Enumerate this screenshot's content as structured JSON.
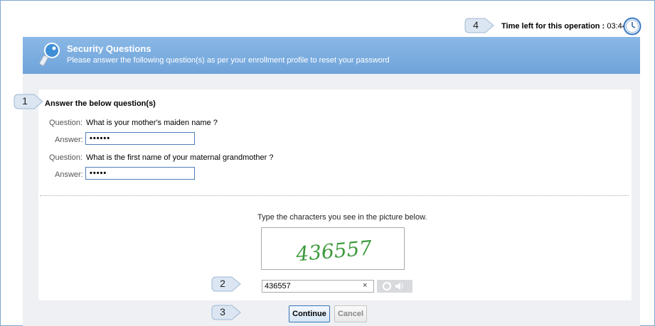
{
  "timer": {
    "label": "Time left for this operation :",
    "value": "03:44"
  },
  "header": {
    "title": "Security Questions",
    "subtitle": "Please answer the following question(s) as per your enrollment profile to reset your password"
  },
  "callouts": [
    "1",
    "2",
    "3",
    "4"
  ],
  "form": {
    "title": "Answer the below question(s)",
    "question_label": "Question:",
    "answer_label": "Answer:",
    "questions": [
      {
        "text": "What is your mother's maiden name ?",
        "answer_masked": "••••••"
      },
      {
        "text": "What is the first name of your maternal grandmother ?",
        "answer_masked": "•••••"
      }
    ]
  },
  "captcha": {
    "hint": "Type the characters you see in the picture below.",
    "image_text": "436557",
    "input_value": "436557",
    "clear_label": "×"
  },
  "buttons": {
    "continue": "Continue",
    "cancel": "Cancel"
  },
  "colors": {
    "header": "#7ab0e2",
    "captcha_text": "#3c9a3c",
    "accent_border": "#4d7fb8"
  }
}
